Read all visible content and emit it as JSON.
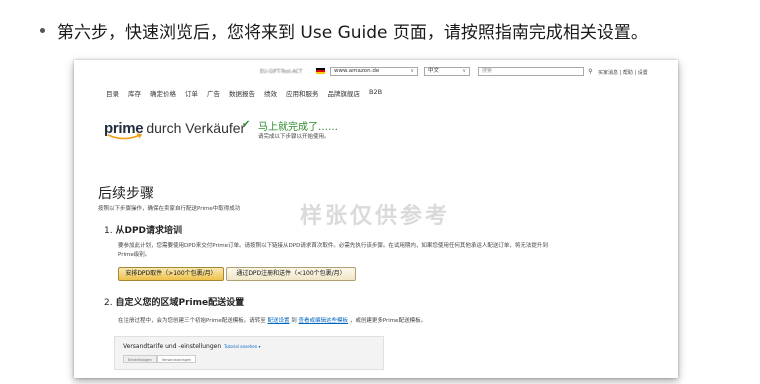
{
  "caption": "第六步，快速浏览后，您将来到 Use Guide 页面，请按照指南完成相关设置。",
  "topbar": {
    "account": "EU-GIFT-Test-ACT",
    "marketplace": "www.amazon.de",
    "language": "中文",
    "search_placeholder": "搜索",
    "links": "买家消息 | 帮助 | 设置"
  },
  "nav": [
    "目录",
    "库存",
    "确定价格",
    "订单",
    "广告",
    "数据报告",
    "绩效",
    "应用和服务",
    "品牌旗舰店",
    "B2B"
  ],
  "prime": {
    "word": "prime",
    "sub": "durch Verkäufer"
  },
  "done": {
    "title": "马上就完成了……",
    "sub": "请完成以下步骤以开始使用。"
  },
  "next": {
    "title": "后续步骤",
    "sub": "按照以下步骤操作，确保在卖家自行配送Prime中取得成功"
  },
  "watermark": "样张仅供参考",
  "step1": {
    "num": "1.",
    "title": "从DPD请求培训",
    "body": "要参加此计划，您需要使用DPD来交付Prime订单。请按照以下链接从DPD请求首次取件。必需先执行该步骤。在试用期内，如果您使用任何其他承运人配送订单，将无法提升到Prime级别。",
    "button1": "安排DPD取件（>100个包裹/月）",
    "button2": "通过DPD注册和送件（<100个包裹/月）"
  },
  "step2": {
    "num": "2.",
    "title": "自定义您的区域Prime配送设置",
    "body_pre": "在注册过程中，会为您创建三个初始Prime配送模板。请转至",
    "link1": "配送设置",
    "body_mid": "到",
    "link2": "查看或编辑这些模板",
    "body_post": "，或创建更多Prime配送模板。"
  },
  "panel": {
    "title": "Versandtarife und -einstellungen",
    "more": "Tutorial ansehen ▾",
    "tabs": [
      "Einstellungen",
      "Versandvorlagen"
    ]
  }
}
